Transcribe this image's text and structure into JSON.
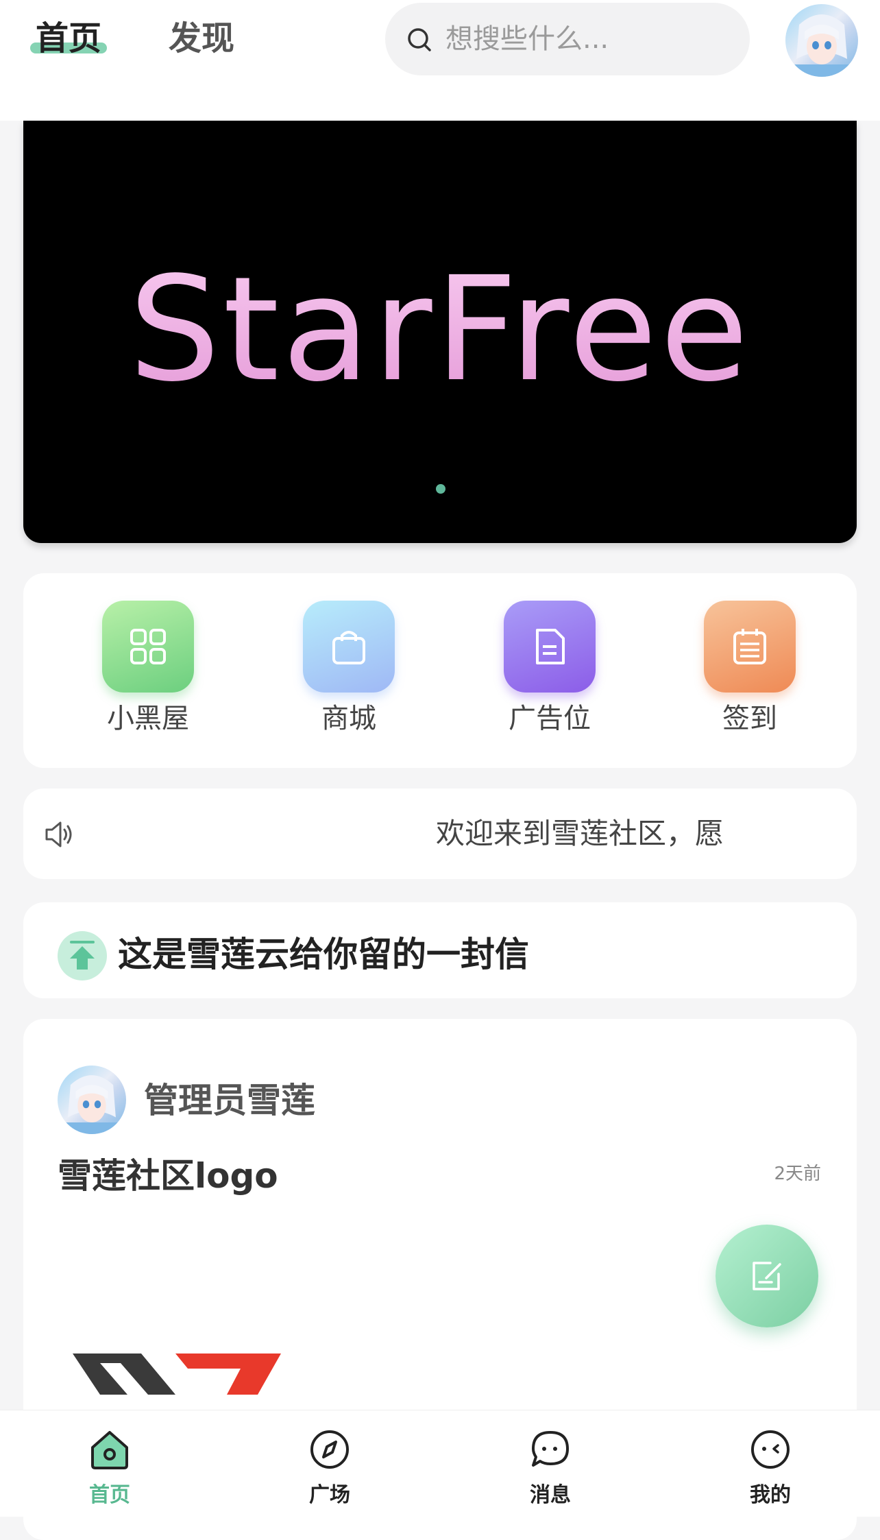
{
  "header": {
    "tabs": [
      {
        "label": "首页",
        "active": true
      },
      {
        "label": "发现",
        "active": false
      }
    ],
    "search": {
      "placeholder": "想搜些什么..."
    }
  },
  "banner": {
    "text": "StarFree",
    "slide_index": 1,
    "slide_count": 1
  },
  "quick_entries": [
    {
      "label": "小黑屋",
      "icon": "grid-icon"
    },
    {
      "label": "商城",
      "icon": "shopping-bag-icon"
    },
    {
      "label": "广告位",
      "icon": "document-icon"
    },
    {
      "label": "签到",
      "icon": "calendar-checklist-icon"
    }
  ],
  "notice": {
    "icon": "speaker-icon",
    "text": "欢迎来到雪莲社区，愿"
  },
  "pinned": {
    "icon": "pin-top-icon",
    "text": "这是雪莲云给你留的一封信"
  },
  "post": {
    "author": "管理员雪莲",
    "title": "雪莲社区logo",
    "time": "2天前"
  },
  "fab": {
    "icon": "edit-note-icon"
  },
  "tabbar": {
    "items": [
      {
        "label": "首页",
        "icon": "home-icon",
        "active": true
      },
      {
        "label": "广场",
        "icon": "compass-icon",
        "active": false
      },
      {
        "label": "消息",
        "icon": "chat-icon",
        "active": false
      },
      {
        "label": "我的",
        "icon": "face-icon",
        "active": false
      }
    ]
  },
  "colors": {
    "accent": "#58b890",
    "banner_text": "#f2b8e6",
    "page_bg": "#f5f5f6"
  }
}
